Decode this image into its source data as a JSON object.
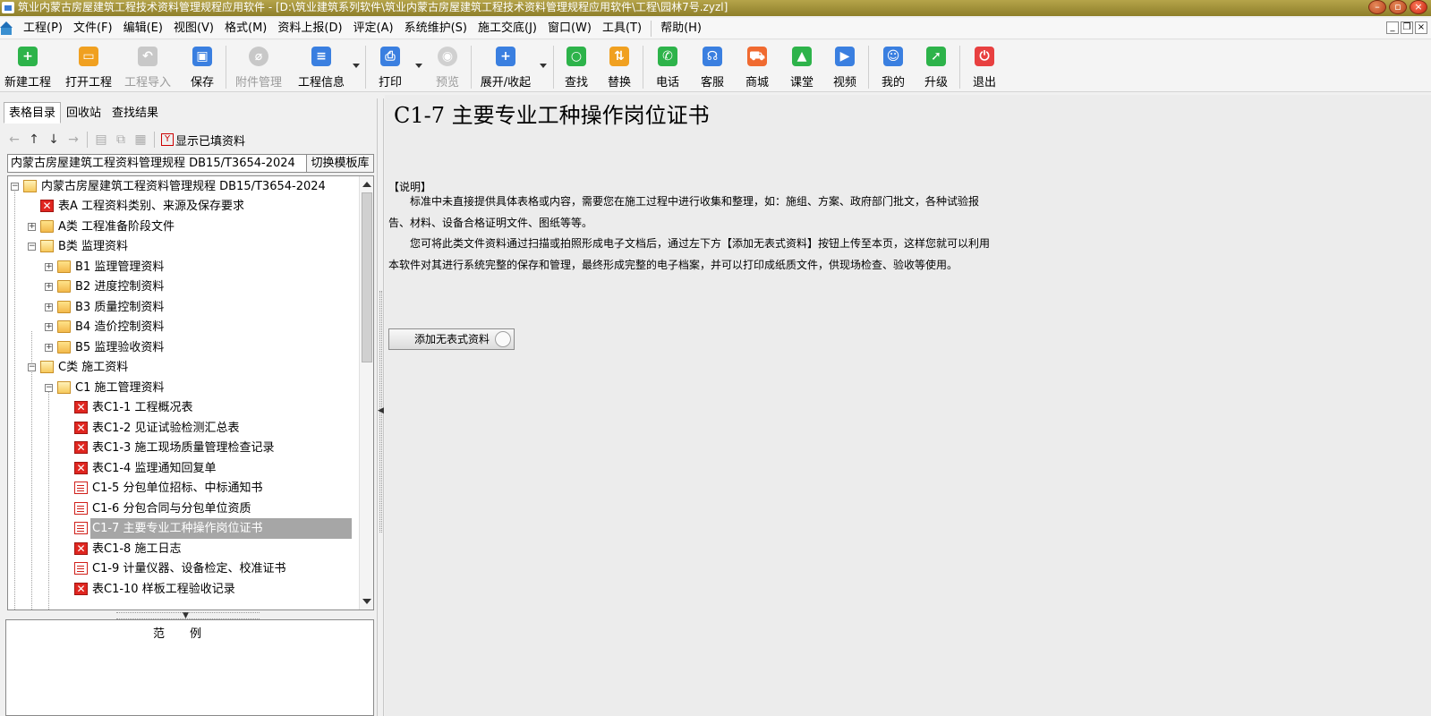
{
  "window": {
    "title": "筑业内蒙古房屋建筑工程技术资料管理规程应用软件 - [D:\\筑业建筑系列软件\\筑业内蒙古房屋建筑工程技术资料管理规程应用软件\\工程\\园林7号.zyzl]"
  },
  "menu": [
    "工程(P)",
    "文件(F)",
    "编辑(E)",
    "视图(V)",
    "格式(M)",
    "资料上报(D)",
    "评定(A)",
    "系统维护(S)",
    "施工交底(J)",
    "窗口(W)",
    "工具(T)",
    "帮助(H)"
  ],
  "toolbar": {
    "new": "新建工程",
    "open": "打开工程",
    "import": "工程导入",
    "save": "保存",
    "attach": "附件管理",
    "info": "工程信息",
    "print": "打印",
    "preview": "预览",
    "expand": "展开/收起",
    "find": "查找",
    "replace": "替换",
    "phone": "电话",
    "service": "客服",
    "shop": "商城",
    "class": "课堂",
    "video": "视频",
    "mine": "我的",
    "upgrade": "升级",
    "exit": "退出"
  },
  "left": {
    "tabs": [
      "表格目录",
      "回收站",
      "查找结果"
    ],
    "show_filled": "显示已填资料",
    "standard": "内蒙古房屋建筑工程资料管理规程 DB15/T3654-2024",
    "switch_lib": "切换模板库",
    "example_title": "范例"
  },
  "tree": [
    {
      "label": "内蒙古房屋建筑工程资料管理规程 DB15/T3654-2024",
      "icon": "folder-open-icon"
    },
    {
      "label": "表A 工程资料类别、来源及保存要求",
      "icon": "red-form-icon"
    },
    {
      "label": "A类 工程准备阶段文件",
      "icon": "folder-icon"
    },
    {
      "label": "B类 监理资料",
      "icon": "folder-open-icon"
    },
    {
      "label": "B1 监理管理资料",
      "icon": "folder-icon"
    },
    {
      "label": "B2 进度控制资料",
      "icon": "folder-icon"
    },
    {
      "label": "B3 质量控制资料",
      "icon": "folder-icon"
    },
    {
      "label": "B4 造价控制资料",
      "icon": "folder-icon"
    },
    {
      "label": "B5 监理验收资料",
      "icon": "folder-icon"
    },
    {
      "label": "C类 施工资料",
      "icon": "folder-open-icon"
    },
    {
      "label": "C1 施工管理资料",
      "icon": "folder-open-icon"
    },
    {
      "label": "表C1-1 工程概况表",
      "icon": "red-form-icon"
    },
    {
      "label": "表C1-2 见证试验检测汇总表",
      "icon": "red-form-icon"
    },
    {
      "label": "表C1-3 施工现场质量管理检查记录",
      "icon": "red-form-icon"
    },
    {
      "label": "表C1-4 监理通知回复单",
      "icon": "red-form-icon"
    },
    {
      "label": "C1-5 分包单位招标、中标通知书",
      "icon": "document-icon"
    },
    {
      "label": "C1-6 分包合同与分包单位资质",
      "icon": "document-icon"
    },
    {
      "label": "C1-7 主要专业工种操作岗位证书",
      "icon": "document-icon"
    },
    {
      "label": "表C1-8 施工日志",
      "icon": "red-form-icon"
    },
    {
      "label": "C1-9 计量仪器、设备检定、校准证书",
      "icon": "document-icon"
    },
    {
      "label": "表C1-10 样板工程验收记录",
      "icon": "red-form-icon"
    }
  ],
  "main": {
    "title": "C1-7 主要专业工种操作岗位证书",
    "note_head": "【说明】",
    "para1": "标准中未直接提供具体表格或内容，需要您在施工过程中进行收集和整理，如：施组、方案、政府部门批文，各种试验报告、材料、设备合格证明文件、图纸等等。",
    "para2": "您可将此类文件资料通过扫描或拍照形成电子文档后，通过左下方【添加无表式资料】按钮上传至本页，这样您就可以利用本软件对其进行系统完整的保存和管理，最终形成完整的电子档案，并可以打印成纸质文件，供现场检查、验收等使用。",
    "add_button": "添加无表式资料"
  },
  "colors": {
    "title_bar": "#9a8b33",
    "selected_row": "#a6a6a6",
    "green_icon": "#2db34a",
    "blue_icon": "#3a7fe0",
    "orange_icon": "#f0a020",
    "red_icon": "#e84040"
  }
}
